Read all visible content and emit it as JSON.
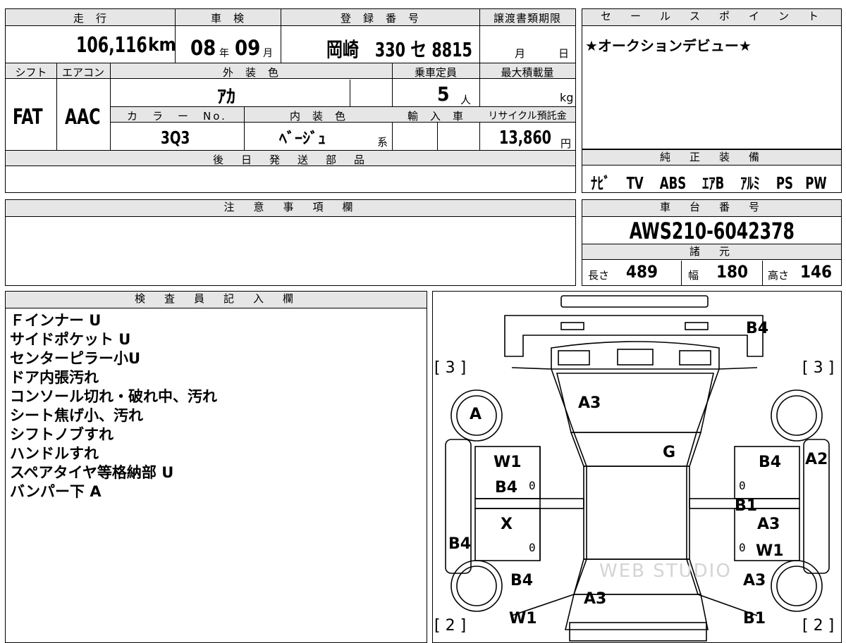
{
  "vehicle": {
    "header": {
      "mileage": "走　行",
      "inspection": "車　検",
      "registration": "登　録　番　号",
      "transfer_deadline": "譲渡書類期限",
      "shift": "シフト",
      "aircon": "エアコン",
      "exterior_color": "外　装　色",
      "capacity": "乗車定員",
      "max_load": "最大積載量",
      "color_no": "カ　ラ　ー　No.",
      "interior_color": "内　装　色",
      "import": "輸　入　車",
      "recycle": "リサイクル預託金",
      "later_parts": "後　日　発　送　部　品"
    },
    "mileage_value": "106,116",
    "mileage_unit": "km",
    "inspection_year": "08",
    "inspection_year_unit": "年",
    "inspection_month": "09",
    "inspection_month_unit": "月",
    "registration_number": "岡崎　330 セ 8815",
    "deadline_month_unit": "月",
    "deadline_day_unit": "日",
    "shift_value": "FAT",
    "aircon_value": "AAC",
    "exterior_color_value": "ｱｶ",
    "capacity_value": "5",
    "capacity_unit": "人",
    "load_unit": "kg",
    "color_no_value": "3Q3",
    "interior_color_value": "ﾍﾞｰｼﾞｭ",
    "interior_color_suffix": "系",
    "recycle_value": "13,860",
    "recycle_unit": "円"
  },
  "sales_point": {
    "header": "セ　ー　ル　ス　ポ　イ　ン　ト",
    "text": "★オークションデビュー★"
  },
  "equipment": {
    "header": "純　正　装　備",
    "items": [
      "ﾅﾋﾞ",
      "TV",
      "ABS",
      "ｴｱB",
      "ｱﾙﾐ",
      "PS",
      "PW"
    ]
  },
  "notes": {
    "header": "注　意　事　項　欄"
  },
  "chassis": {
    "header": "車　台　番　号",
    "value": "AWS210-6042378",
    "specs_header": "諸　元",
    "length_label": "長さ",
    "length_value": "489",
    "width_label": "幅",
    "width_value": "180",
    "height_label": "高さ",
    "height_value": "146"
  },
  "inspector": {
    "header": "検　査　員　記　入　欄",
    "lines": [
      "Ｆインナー U",
      "サイドポケット U",
      "センターピラー小U",
      "ドア内張汚れ",
      "コンソール切れ・破れ中、汚れ",
      "シート焦げ小、汚れ",
      "シフトノブすれ",
      "ハンドルすれ",
      "スペアタイヤ等格納部 U",
      "バンパー下 A"
    ]
  },
  "diagram": {
    "tire_fl": "[ 3 ]",
    "tire_fr": "[ 3 ]",
    "tire_rl": "[ 2 ]",
    "tire_rr": "[ 2 ]",
    "marks": {
      "rear_b4": "B4",
      "hood_a3": "A3",
      "wheel_a": "A",
      "roof_g": "G",
      "fl_w1": "W1",
      "fl_b4": "B4",
      "rl_x": "X",
      "left_b4": "B4",
      "fr_b4": "B4",
      "right_a2": "A2",
      "right_b1": "B1",
      "rr_a3": "A3",
      "rr_w1": "W1",
      "lower_left_b4": "B4",
      "lower_left_w1": "W1",
      "trunk_a3": "A3",
      "lower_right_a3": "A3",
      "lower_right_b1": "B1"
    },
    "zeros": [
      "0",
      "0",
      "0",
      "0"
    ],
    "watermark": "WEB STUDIO"
  }
}
